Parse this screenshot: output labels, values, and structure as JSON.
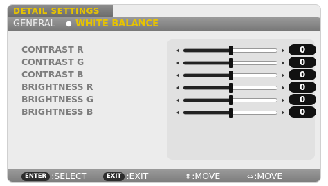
{
  "menu": {
    "title": "DETAIL SETTINGS",
    "tabs": [
      {
        "label": "GENERAL",
        "active": false
      },
      {
        "label": "WHITE BALANCE",
        "active": true
      }
    ],
    "tab_separator": "●",
    "params": [
      {
        "label": "CONTRAST R",
        "value": "0",
        "slider_fraction": 0.5
      },
      {
        "label": "CONTRAST G",
        "value": "0",
        "slider_fraction": 0.5
      },
      {
        "label": "CONTRAST B",
        "value": "0",
        "slider_fraction": 0.5
      },
      {
        "label": "BRIGHTNESS R",
        "value": "0",
        "slider_fraction": 0.5
      },
      {
        "label": "BRIGHTNESS G",
        "value": "0",
        "slider_fraction": 0.5
      },
      {
        "label": "BRIGHTNESS B",
        "value": "0",
        "slider_fraction": 0.5
      }
    ],
    "footer": [
      {
        "key": "ENTER",
        "text": ":SELECT"
      },
      {
        "key": "EXIT",
        "text": ":EXIT"
      },
      {
        "glyph": "⇕",
        "text": ":MOVE"
      },
      {
        "glyph": "⇔",
        "text": ":MOVE"
      }
    ]
  },
  "colors": {
    "accent": "#e7c300",
    "label_gray": "#7d7d7d",
    "bar_gray": "#8a8a8a"
  },
  "icons": [
    "left-arrow-icon",
    "right-arrow-icon",
    "up-down-arrow-icon",
    "left-right-arrow-icon"
  ]
}
